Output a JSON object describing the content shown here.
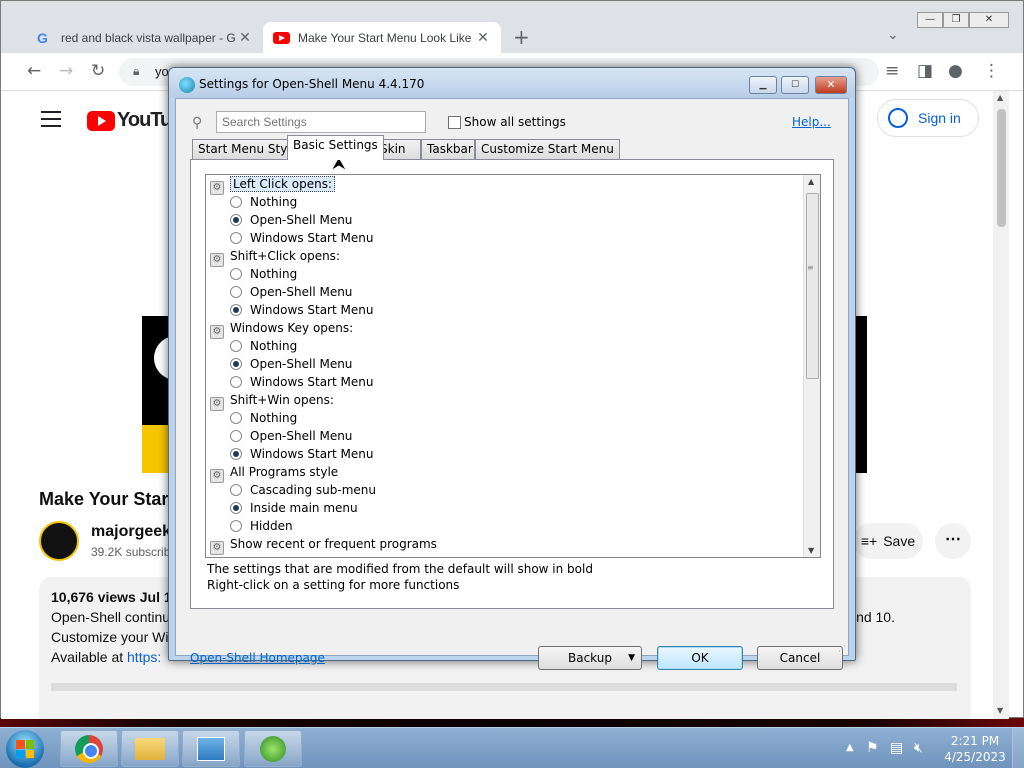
{
  "browser": {
    "tabs": [
      {
        "title": "red and black vista wallpaper - G",
        "favicon": "google-icon",
        "active": false
      },
      {
        "title": "Make Your Start Menu Look Like",
        "favicon": "youtube-icon",
        "active": true
      }
    ],
    "new_tab": "+",
    "address_partial": "yo",
    "window_controls": [
      "minimize",
      "maximize",
      "close"
    ]
  },
  "youtube": {
    "logo_text": "YouTube",
    "sign_in": "Sign in",
    "video_title": "Make Your Star",
    "channel_name": "majorgeeks",
    "channel_subs": "39.2K subscrib",
    "save": "Save",
    "more": "⋯",
    "views": "10,676 views  Jul 1",
    "desc_line1": "Open-Shell continu",
    "desc_line1_right": "nd 10.",
    "desc_line2": "Customize your Wi",
    "desc_line3_prefix": "Available at ",
    "desc_link": "https:"
  },
  "dialog": {
    "title": "Settings for Open-Shell Menu 4.4.170",
    "search_placeholder": "Search Settings",
    "show_all": "Show all settings",
    "help": "Help...",
    "tabs": [
      "Start Menu Style",
      "Basic Settings",
      "Skin",
      "Taskbar",
      "Customize Start Menu"
    ],
    "selected_tab": "Basic Settings",
    "groups": [
      {
        "label": "Left Click opens:",
        "options": [
          {
            "label": "Nothing",
            "checked": false
          },
          {
            "label": "Open-Shell Menu",
            "checked": true
          },
          {
            "label": "Windows Start Menu",
            "checked": false
          }
        ]
      },
      {
        "label": "Shift+Click opens:",
        "options": [
          {
            "label": "Nothing",
            "checked": false
          },
          {
            "label": "Open-Shell Menu",
            "checked": false
          },
          {
            "label": "Windows Start Menu",
            "checked": true
          }
        ]
      },
      {
        "label": "Windows Key opens:",
        "options": [
          {
            "label": "Nothing",
            "checked": false
          },
          {
            "label": "Open-Shell Menu",
            "checked": true
          },
          {
            "label": "Windows Start Menu",
            "checked": false
          }
        ]
      },
      {
        "label": "Shift+Win opens:",
        "options": [
          {
            "label": "Nothing",
            "checked": false
          },
          {
            "label": "Open-Shell Menu",
            "checked": false
          },
          {
            "label": "Windows Start Menu",
            "checked": true
          }
        ]
      },
      {
        "label": "All Programs style",
        "options": [
          {
            "label": "Cascading sub-menu",
            "checked": false
          },
          {
            "label": "Inside main menu",
            "checked": true
          },
          {
            "label": "Hidden",
            "checked": false
          }
        ]
      },
      {
        "label": "Show recent or frequent programs",
        "options": []
      }
    ],
    "hint1": "The settings that are modified from the default will show in bold",
    "hint2": "Right-click on a setting for more functions",
    "homepage": "Open-Shell Homepage",
    "backup": "Backup",
    "ok": "OK",
    "cancel": "Cancel"
  },
  "taskbar": {
    "time": "2:21 PM",
    "date": "4/25/2023",
    "pinned": [
      "chrome-icon",
      "explorer-folder-icon",
      "control-panel-icon",
      "open-shell-icon"
    ]
  },
  "colors": {
    "accent_blue": "#065fd4",
    "youtube_red": "#ff0000",
    "link": "#0066cc"
  }
}
